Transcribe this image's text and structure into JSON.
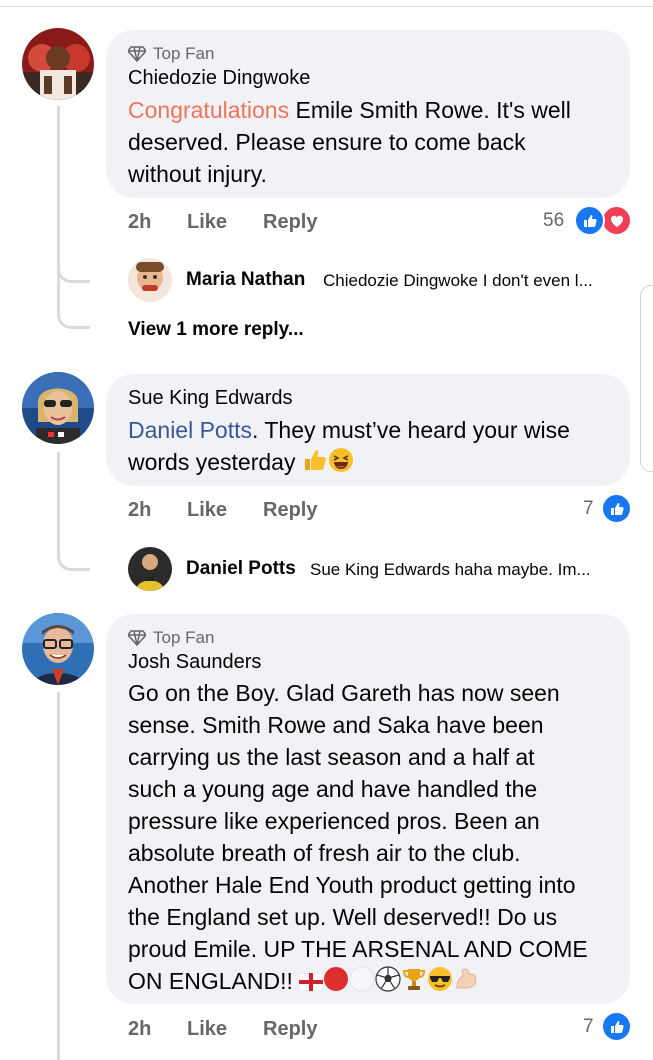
{
  "comments": [
    {
      "badge": "Top Fan",
      "author": "Chiedozie Dingwoke",
      "highlight": "Congratulations",
      "text_line1": " Emile Smith Rowe. It's well",
      "text_line2": "deserved. Please ensure to come back",
      "text_line3": "without injury.",
      "time": "2h",
      "like": "Like",
      "reply": "Reply",
      "reaction_count": "56",
      "reactions": [
        "like",
        "love"
      ],
      "replies": [
        {
          "author": "Maria Nathan",
          "text": "Chiedozie Dingwoke I don't even l..."
        }
      ],
      "more_replies": "View 1 more reply..."
    },
    {
      "author": "Sue King Edwards",
      "tag": "Daniel Potts",
      "text_line1": ".  They must’ve heard your wise",
      "text_line2": "words yesterday",
      "time": "2h",
      "like": "Like",
      "reply": "Reply",
      "reaction_count": "7",
      "reactions": [
        "like"
      ],
      "replies": [
        {
          "author": "Daniel Potts",
          "text": "Sue King Edwards haha maybe. Im..."
        }
      ]
    },
    {
      "badge": "Top Fan",
      "author": "Josh Saunders",
      "lines": [
        "Go on the Boy. Glad Gareth has now seen",
        "sense. Smith Rowe and Saka have been",
        "carrying us the last season and a half at",
        "such a young age and have handled the",
        "pressure like experienced pros. Been an",
        "absolute breath of fresh air to the club.",
        "Another Hale End Youth product getting into",
        "the England set up. Well deserved!! Do us",
        "proud Emile. UP THE ARSENAL AND COME",
        "ON ENGLAND!!"
      ],
      "time": "2h",
      "like": "Like",
      "reply": "Reply",
      "reaction_count": "7",
      "reactions": [
        "like"
      ]
    }
  ],
  "colors": {
    "like_blue": "#1877f2",
    "love_red": "#f33e58",
    "tag_blue": "#385898",
    "highlight_orange": "#f0735b",
    "bubble_grey": "#f0f2f5"
  }
}
